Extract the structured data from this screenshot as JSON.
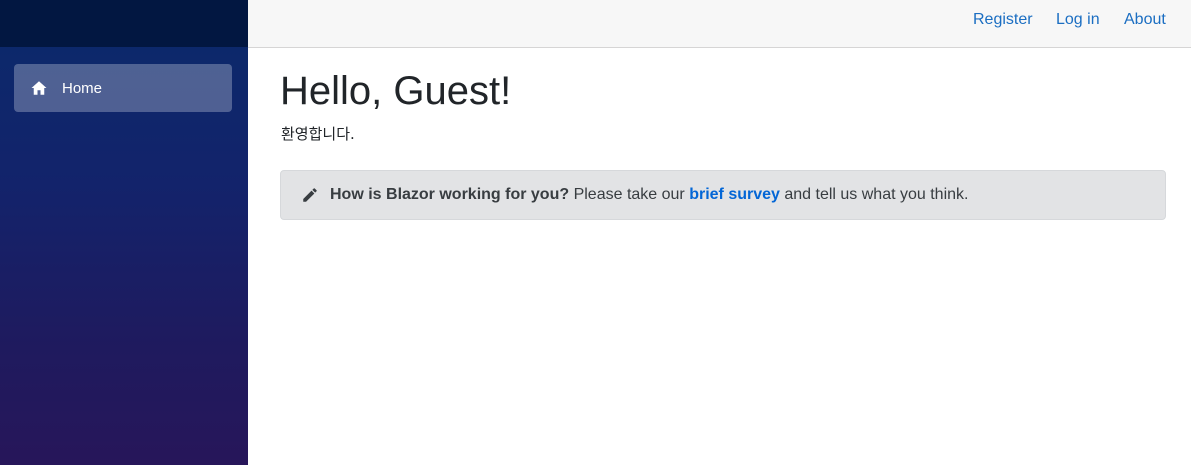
{
  "sidebar": {
    "items": [
      {
        "label": "Home",
        "icon": "home-icon",
        "active": true
      }
    ]
  },
  "topbar": {
    "links": {
      "register": "Register",
      "login": "Log in",
      "about": "About"
    }
  },
  "main": {
    "title": "Hello, Guest!",
    "welcome": "환영합니다.",
    "survey": {
      "icon": "pencil-icon",
      "question": "How is Blazor working for you?",
      "text_before": " Please take our ",
      "link_label": "brief survey",
      "text_after": " and tell us what you think."
    }
  },
  "colors": {
    "sidebar_top": "#021741",
    "sidebar_gradient_start": "#0a2a6b",
    "sidebar_gradient_end": "#27165a",
    "link": "#1b6ec2",
    "alert_background": "#e2e3e5"
  }
}
